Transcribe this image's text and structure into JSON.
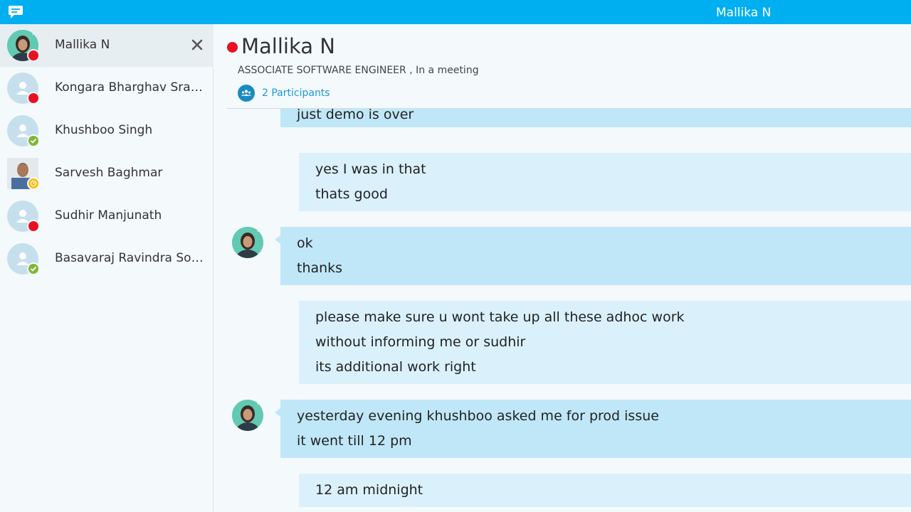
{
  "titlebar": {
    "title": "Mallika N",
    "accent": "#00aff0"
  },
  "sidebar": {
    "contacts": [
      {
        "name": "Mallika N",
        "status": "busy",
        "avatar": "photo",
        "active": true
      },
      {
        "name": "Kongara Bharghav Sravan",
        "status": "busy",
        "avatar": "placeholder"
      },
      {
        "name": "Khushboo Singh",
        "status": "online",
        "avatar": "placeholder"
      },
      {
        "name": "Sarvesh Baghmar",
        "status": "away",
        "avatar": "photo"
      },
      {
        "name": "Sudhir Manjunath",
        "status": "busy",
        "avatar": "placeholder"
      },
      {
        "name": "Basavaraj Ravindra Somashekar",
        "status": "online",
        "avatar": "placeholder"
      }
    ]
  },
  "conversation": {
    "name": "Mallika N",
    "title": "ASSOCIATE SOFTWARE ENGINEER",
    "status_text": "In a meeting",
    "mood_line": "ASSOCIATE SOFTWARE ENGINEER , In a meeting",
    "participants": "2 Participants",
    "messages": [
      {
        "sender": "them",
        "lines": [
          "just demo is over"
        ]
      },
      {
        "sender": "me",
        "lines": [
          "yes I was in that",
          "thats good"
        ]
      },
      {
        "sender": "them",
        "lines": [
          "ok",
          "thanks"
        ]
      },
      {
        "sender": "me",
        "lines": [
          "please make sure u wont take up all these adhoc work",
          "without informing me or sudhir",
          "its additional work right"
        ]
      },
      {
        "sender": "them",
        "lines": [
          "yesterday evening khushboo asked me for prod issue",
          "it went till 12 pm"
        ]
      },
      {
        "sender": "me",
        "lines": [
          "12 am midnight"
        ]
      }
    ]
  },
  "colors": {
    "busy": "#e81123",
    "online": "#7cb82f",
    "away": "#ffb900",
    "bubble_theirs": "#c0e7f8",
    "bubble_mine": "#daf1fb",
    "link": "#1a9ad6"
  }
}
